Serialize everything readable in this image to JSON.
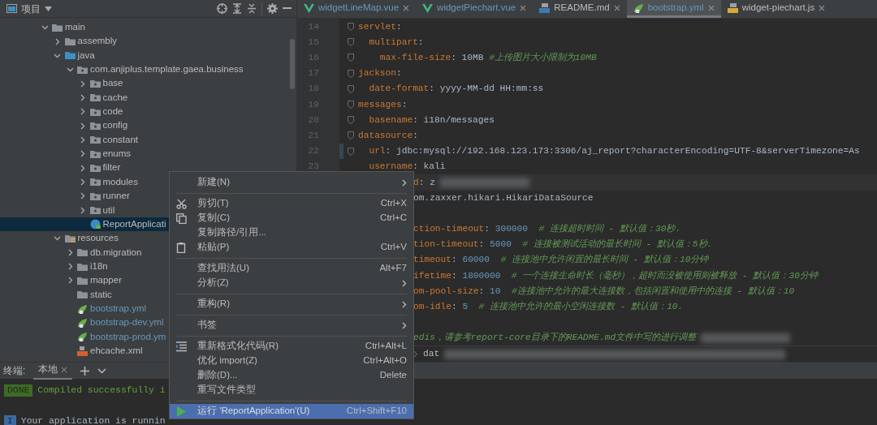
{
  "project_panel": {
    "title": "项目",
    "tree": [
      {
        "label": "main",
        "kind": "folder",
        "expanded": true,
        "children": [
          {
            "label": "assembly",
            "kind": "folder",
            "expanded": false
          },
          {
            "label": "java",
            "kind": "source-folder",
            "expanded": true,
            "children": [
              {
                "label": "com.anjiplus.template.gaea.business",
                "kind": "package",
                "expanded": true,
                "children": [
                  {
                    "label": "base",
                    "kind": "package",
                    "expanded": false
                  },
                  {
                    "label": "cache",
                    "kind": "package",
                    "expanded": false
                  },
                  {
                    "label": "code",
                    "kind": "package",
                    "expanded": false
                  },
                  {
                    "label": "config",
                    "kind": "package",
                    "expanded": false
                  },
                  {
                    "label": "constant",
                    "kind": "package",
                    "expanded": false
                  },
                  {
                    "label": "enums",
                    "kind": "package",
                    "expanded": false
                  },
                  {
                    "label": "filter",
                    "kind": "package",
                    "expanded": false
                  },
                  {
                    "label": "modules",
                    "kind": "package",
                    "expanded": false
                  },
                  {
                    "label": "runner",
                    "kind": "package",
                    "expanded": false
                  },
                  {
                    "label": "util",
                    "kind": "package",
                    "expanded": false
                  },
                  {
                    "label": "ReportApplicati",
                    "kind": "class",
                    "selected": true
                  }
                ]
              }
            ]
          },
          {
            "label": "resources",
            "kind": "resources",
            "expanded": true,
            "children": [
              {
                "label": "db.migration",
                "kind": "folder",
                "expanded": false
              },
              {
                "label": "i18n",
                "kind": "folder",
                "expanded": false
              },
              {
                "label": "mapper",
                "kind": "folder",
                "expanded": false
              },
              {
                "label": "static",
                "kind": "folder"
              },
              {
                "label": "bootstrap.yml",
                "kind": "spring",
                "changed": true
              },
              {
                "label": "bootstrap-dev.yml",
                "kind": "spring",
                "changed": true
              },
              {
                "label": "bootstrap-prod.ym",
                "kind": "spring",
                "changed": true
              },
              {
                "label": "ehcache.xml",
                "kind": "xml",
                "changed": false
              }
            ]
          }
        ]
      }
    ]
  },
  "editor": {
    "tabs": [
      {
        "label": "widgetLineMap.vue",
        "kind": "vue",
        "changed": true,
        "selected": false
      },
      {
        "label": "widgetPiechart.vue",
        "kind": "vue",
        "changed": true,
        "selected": false
      },
      {
        "label": "README.md",
        "kind": "md",
        "changed": false,
        "selected": false
      },
      {
        "label": "bootstrap.yml",
        "kind": "spring",
        "changed": true,
        "selected": true
      },
      {
        "label": "widget-piechart.js",
        "kind": "js",
        "changed": false,
        "selected": false
      }
    ],
    "lines": [
      {
        "kind": "code",
        "number": "14",
        "fold": true,
        "segments": [
          {
            "kind": "key",
            "text": "servlet"
          },
          {
            "kind": "plain",
            "text": ":"
          }
        ]
      },
      {
        "kind": "code",
        "number": "15",
        "fold": true,
        "segments": [
          {
            "kind": "key",
            "text": "  multipart"
          },
          {
            "kind": "plain",
            "text": ":"
          }
        ]
      },
      {
        "kind": "code",
        "number": "16",
        "fold": true,
        "segments": [
          {
            "kind": "key",
            "text": "    max-file-size"
          },
          {
            "kind": "plain",
            "text": ": 10MB "
          },
          {
            "kind": "comment",
            "text": "#上传图片大小限制为10MB"
          }
        ]
      },
      {
        "kind": "code",
        "number": "17",
        "fold": true,
        "segments": [
          {
            "kind": "key",
            "text": "jackson"
          },
          {
            "kind": "plain",
            "text": ":"
          }
        ]
      },
      {
        "kind": "code",
        "number": "18",
        "fold": true,
        "segments": [
          {
            "kind": "key",
            "text": "  date-format"
          },
          {
            "kind": "plain",
            "text": ": yyyy-MM-dd HH:mm:ss"
          }
        ]
      },
      {
        "kind": "code",
        "number": "19",
        "fold": true,
        "segments": [
          {
            "kind": "key",
            "text": "messages"
          },
          {
            "kind": "plain",
            "text": ":"
          }
        ]
      },
      {
        "kind": "code",
        "number": "20",
        "fold": true,
        "segments": [
          {
            "kind": "key",
            "text": "  basename"
          },
          {
            "kind": "plain",
            "text": ": i18n/messages"
          }
        ]
      },
      {
        "kind": "code",
        "number": "21",
        "fold": true,
        "segments": [
          {
            "kind": "key",
            "text": "datasource"
          },
          {
            "kind": "plain",
            "text": ":"
          }
        ]
      },
      {
        "kind": "code",
        "number": "22",
        "fold": true,
        "changed": true,
        "segments": [
          {
            "kind": "key",
            "text": "  url"
          },
          {
            "kind": "plain",
            "text": ": jdbc:mysql://192.168.123.173:3306/aj_report?characterEncoding=UTF-8&serverTimezone=As"
          }
        ]
      },
      {
        "kind": "code",
        "number": "23",
        "segments": [
          {
            "kind": "key",
            "text": "  username"
          },
          {
            "kind": "plain",
            "text": ": kali"
          }
        ]
      },
      {
        "kind": "code",
        "under_menu": true,
        "current": true,
        "segments": [
          {
            "kind": "key",
            "text": "d"
          },
          {
            "kind": "plain",
            "text": ": z"
          },
          {
            "kind": "blurred"
          }
        ]
      },
      {
        "kind": "code",
        "under_menu": true,
        "segments": [
          {
            "kind": "plain",
            "text": "om.zaxxer.hikari.HikariDataSource"
          }
        ]
      },
      {
        "kind": "blank"
      },
      {
        "kind": "code",
        "under_menu": true,
        "segments": [
          {
            "kind": "key",
            "text": "ction-timeout"
          },
          {
            "kind": "plain",
            "text": ": "
          },
          {
            "kind": "number",
            "text": "300000"
          },
          {
            "kind": "comment",
            "text": "  # 连接超时时间 - 默认值：30秒."
          }
        ]
      },
      {
        "kind": "code",
        "under_menu": true,
        "segments": [
          {
            "kind": "key",
            "text": "tion-timeout"
          },
          {
            "kind": "plain",
            "text": ": "
          },
          {
            "kind": "number",
            "text": "5000"
          },
          {
            "kind": "comment",
            "text": "  # 连接被测试活动的最长时间 - 默认值：5秒."
          }
        ]
      },
      {
        "kind": "code",
        "under_menu": true,
        "segments": [
          {
            "kind": "key",
            "text": "timeout"
          },
          {
            "kind": "plain",
            "text": ": "
          },
          {
            "kind": "number",
            "text": "60000"
          },
          {
            "kind": "comment",
            "text": "  # 连接池中允许闲置的最长时间 - 默认值：10分钟"
          }
        ]
      },
      {
        "kind": "code",
        "under_menu": true,
        "segments": [
          {
            "kind": "key",
            "text": "ifetime"
          },
          {
            "kind": "plain",
            "text": ": "
          },
          {
            "kind": "number",
            "text": "1800000"
          },
          {
            "kind": "comment",
            "text": "  # 一个连接生命时长（毫秒），超时而没被使用则被释放 - 默认值：30分钟"
          }
        ]
      },
      {
        "kind": "code",
        "under_menu": true,
        "segments": [
          {
            "kind": "key",
            "text": "om-pool-size"
          },
          {
            "kind": "plain",
            "text": ": "
          },
          {
            "kind": "number",
            "text": "10"
          },
          {
            "kind": "comment",
            "text": "  #连接池中允许的最大连接数，包括闲置和使用中的连接 - 默认值：10"
          }
        ]
      },
      {
        "kind": "code",
        "under_menu": true,
        "segments": [
          {
            "kind": "key",
            "text": "om-idle"
          },
          {
            "kind": "plain",
            "text": ": "
          },
          {
            "kind": "number",
            "text": "5"
          },
          {
            "kind": "comment",
            "text": "  # 连接池中允许的最小空闲连接数 - 默认值：10."
          }
        ]
      },
      {
        "kind": "blank"
      },
      {
        "kind": "code",
        "under_menu": true,
        "segments": [
          {
            "kind": "comment",
            "text": "edis，请参考report-core目录下的README.md文件中写的进行调整"
          },
          {
            "kind": "blurred"
          }
        ]
      }
    ],
    "breadcrumb": "dat"
  },
  "terminal": {
    "label": "终端:",
    "tabs": [
      {
        "label": "本地",
        "selected": true
      }
    ],
    "lines": [
      {
        "badge": "DONE",
        "kind": "done",
        "text": "Compiled successfully i"
      },
      {
        "badge": "I",
        "kind": "info",
        "text": "Your application is runnin"
      }
    ]
  },
  "context_menu": {
    "groups": [
      [
        {
          "label": "新建(N)",
          "submenu": true
        }
      ],
      [
        {
          "label": "剪切(T)",
          "kind": "scissors",
          "shortcut": "Ctrl+X"
        },
        {
          "label": "复制(C)",
          "kind": "copy",
          "shortcut": "Ctrl+C"
        },
        {
          "label": "复制路径/引用..."
        },
        {
          "label": "粘贴(P)",
          "kind": "paste",
          "shortcut": "Ctrl+V"
        }
      ],
      [
        {
          "label": "查找用法(U)",
          "shortcut": "Alt+F7"
        },
        {
          "label": "分析(Z)",
          "submenu": true
        }
      ],
      [
        {
          "label": "重构(R)",
          "submenu": true
        }
      ],
      [
        {
          "label": "书签",
          "submenu": true
        }
      ],
      [
        {
          "label": "重新格式化代码(R)",
          "kind": "format",
          "shortcut": "Ctrl+Alt+L"
        },
        {
          "label": "优化 import(Z)",
          "shortcut": "Ctrl+Alt+O"
        },
        {
          "label": "删除(D)...",
          "shortcut": "Delete"
        },
        {
          "label": "重写文件类型"
        }
      ],
      [
        {
          "label": "运行 'ReportApplication'(U)",
          "kind": "run",
          "shortcut": "Ctrl+Shift+F10",
          "selected": true
        }
      ]
    ]
  }
}
